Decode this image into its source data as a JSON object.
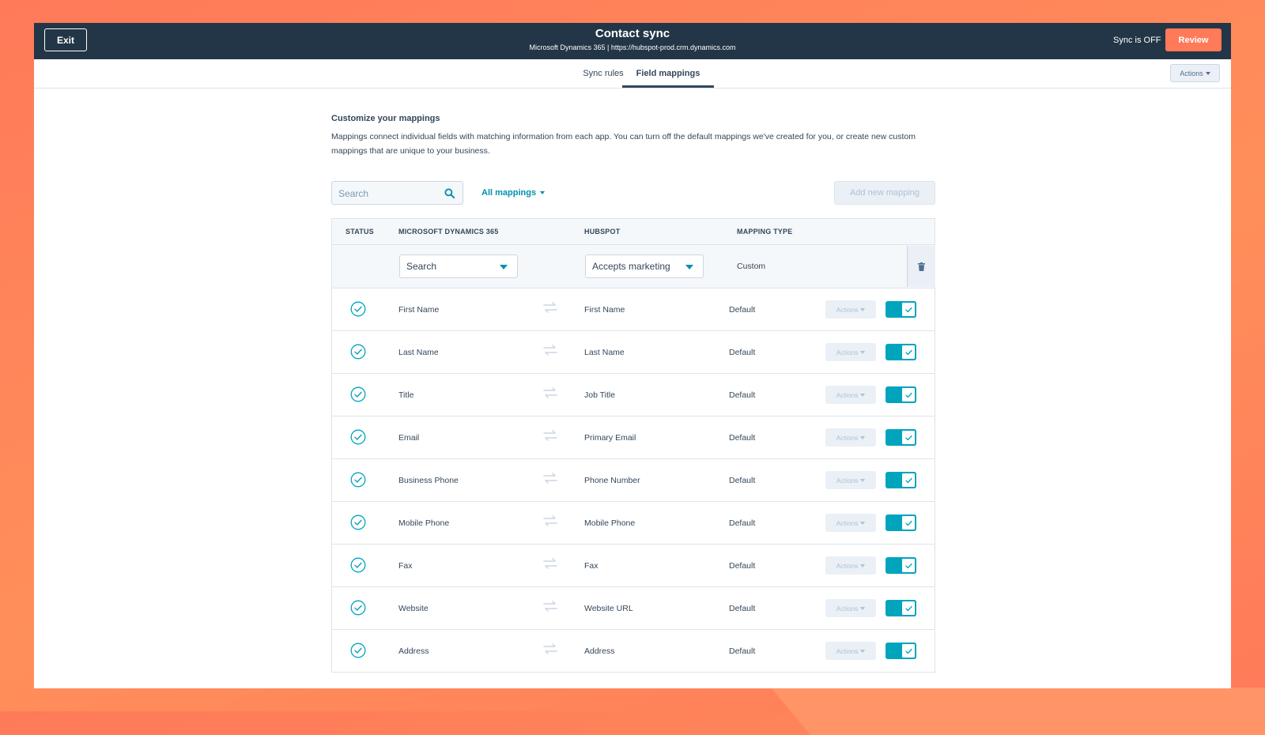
{
  "header": {
    "exit_label": "Exit",
    "title": "Contact sync",
    "subtitle": "Microsoft Dynamics 365 | https://hubspot-prod.crm.dynamics.com",
    "sync_status": "Sync is OFF",
    "review_label": "Review"
  },
  "tabs": [
    {
      "label": "Sync rules",
      "active": false
    },
    {
      "label": "Field mappings",
      "active": true
    }
  ],
  "top_actions_label": "Actions",
  "section": {
    "title": "Customize your mappings",
    "description": "Mappings connect individual fields with matching information from each app. You can turn off the default mappings we've created for you, or create new custom mappings that are unique to your business."
  },
  "toolbar": {
    "search_placeholder": "Search",
    "filter_label": "All mappings",
    "add_label": "Add new mapping"
  },
  "table": {
    "columns": [
      "STATUS",
      "MICROSOFT DYNAMICS 365",
      "HUBSPOT",
      "MAPPING TYPE"
    ],
    "edit_row": {
      "ms_value": "Search",
      "hs_value": "Accepts marketing",
      "type": "Custom"
    },
    "row_action_label": "Actions",
    "rows": [
      {
        "ms": "First Name",
        "hs": "First Name",
        "type": "Default"
      },
      {
        "ms": "Last Name",
        "hs": "Last Name",
        "type": "Default"
      },
      {
        "ms": "Title",
        "hs": "Job Title",
        "type": "Default"
      },
      {
        "ms": "Email",
        "hs": "Primary Email",
        "type": "Default"
      },
      {
        "ms": "Business Phone",
        "hs": "Phone Number",
        "type": "Default"
      },
      {
        "ms": "Mobile Phone",
        "hs": "Mobile Phone",
        "type": "Default"
      },
      {
        "ms": "Fax",
        "hs": "Fax",
        "type": "Default"
      },
      {
        "ms": "Website",
        "hs": "Website URL",
        "type": "Default"
      },
      {
        "ms": "Address",
        "hs": "Address",
        "type": "Default"
      }
    ]
  },
  "colors": {
    "header_bg": "#233647",
    "accent_orange": "#ff7a59",
    "accent_teal": "#00a4bd",
    "link_teal": "#0091ae"
  }
}
